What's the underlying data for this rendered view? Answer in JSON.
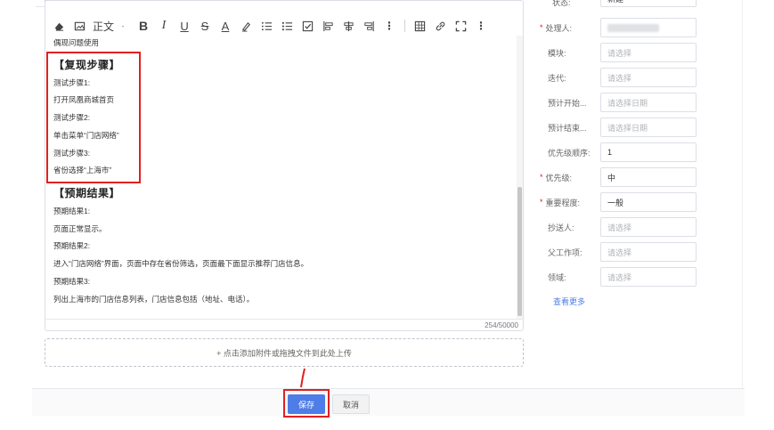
{
  "toolbar": {
    "paragraph_label": "正文",
    "bold_label": "B",
    "italic_label": "I",
    "underline_label": "U",
    "strike_label": "S",
    "fontcolor_label": "A"
  },
  "editor": {
    "lines": [
      {
        "text": "偶现问题使用",
        "heading": false
      },
      {
        "text": "【复现步骤】",
        "heading": true
      },
      {
        "text": "测试步骤1:",
        "heading": false
      },
      {
        "text": "打开凤凰商城首页",
        "heading": false
      },
      {
        "text": "测试步骤2:",
        "heading": false
      },
      {
        "text": "单击菜单“门店网络”",
        "heading": false
      },
      {
        "text": "测试步骤3:",
        "heading": false
      },
      {
        "text": "省份选择“上海市”",
        "heading": false
      },
      {
        "text": "【预期结果】",
        "heading": true
      },
      {
        "text": "预期结果1:",
        "heading": false
      },
      {
        "text": "页面正常显示。",
        "heading": false
      },
      {
        "text": "预期结果2:",
        "heading": false
      },
      {
        "text": "进入“门店网络”界面，页面中存在省份筛选，页面最下面显示推荐门店信息。",
        "heading": false
      },
      {
        "text": "预期结果3:",
        "heading": false
      },
      {
        "text": "列出上海市的门店信息列表，门店信息包括（地址、电话）。",
        "heading": false
      }
    ],
    "char_count": "254/50000"
  },
  "upload": {
    "label": "+ 点击添加附件或拖拽文件到此处上传"
  },
  "footer": {
    "save_label": "保存",
    "cancel_label": "取消"
  },
  "form": {
    "status_label": "状态:",
    "status_value": "新建",
    "fields": [
      {
        "label": "处理人:",
        "required": true,
        "value": "",
        "placeholder": "",
        "blurred": true
      },
      {
        "label": "模块:",
        "required": false,
        "value": "",
        "placeholder": "请选择"
      },
      {
        "label": "迭代:",
        "required": false,
        "value": "",
        "placeholder": "请选择"
      },
      {
        "label": "预计开始...",
        "required": false,
        "value": "",
        "placeholder": "请选择日期"
      },
      {
        "label": "预计结束...",
        "required": false,
        "value": "",
        "placeholder": "请选择日期"
      },
      {
        "label": "优先级顺序:",
        "required": false,
        "value": "1",
        "placeholder": ""
      },
      {
        "label": "优先级:",
        "required": true,
        "value": "中",
        "placeholder": ""
      },
      {
        "label": "重要程度:",
        "required": true,
        "value": "一般",
        "placeholder": ""
      },
      {
        "label": "抄送人:",
        "required": false,
        "value": "",
        "placeholder": "请选择"
      },
      {
        "label": "父工作项:",
        "required": false,
        "value": "",
        "placeholder": "请选择"
      },
      {
        "label": "领域:",
        "required": false,
        "value": "",
        "placeholder": "请选择"
      }
    ],
    "see_more_label": "查看更多"
  },
  "colors": {
    "primary": "#4e7de8",
    "highlight_red": "#e02020"
  }
}
